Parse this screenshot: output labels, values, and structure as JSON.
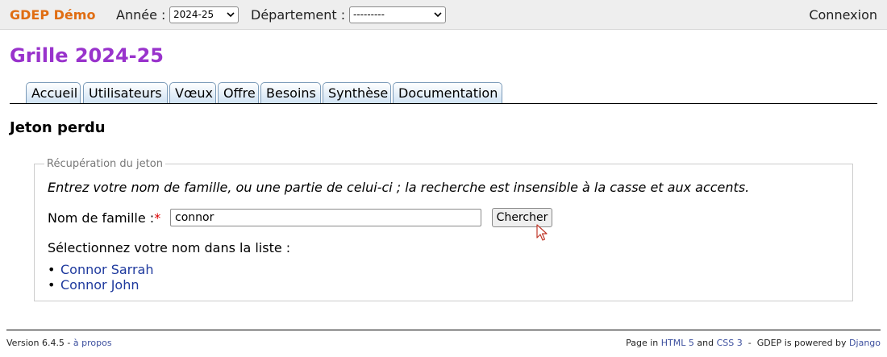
{
  "topbar": {
    "brand": "GDEP Démo",
    "year_label": "Année :",
    "year_value": "2024-25",
    "dept_label": "Département :",
    "dept_value": "---------",
    "login": "Connexion"
  },
  "page_title": "Grille 2024-25",
  "tabs": [
    {
      "label": "Accueil"
    },
    {
      "label": "Utilisateurs"
    },
    {
      "label": "Vœux"
    },
    {
      "label": "Offre"
    },
    {
      "label": "Besoins"
    },
    {
      "label": "Synthèse"
    },
    {
      "label": "Documentation"
    }
  ],
  "section_title": "Jeton perdu",
  "form": {
    "legend": "Récupération du jeton",
    "instructions": "Entrez votre nom de famille, ou une partie de celui-ci ; la recherche est insensible à la casse et aux accents.",
    "name_label": "Nom de famille :",
    "required_mark": "*",
    "name_value": "connor",
    "search_button": "Chercher",
    "select_prompt": "Sélectionnez votre nom dans la liste :",
    "results": [
      "Connor Sarrah",
      "Connor John"
    ]
  },
  "footer": {
    "version": "Version 6.4.5 - ",
    "about": "à propos",
    "page_in": "Page in ",
    "html5": "HTML 5",
    "and": " and ",
    "css3": "CSS 3",
    "powered": "  -  GDEP is powered by ",
    "django": "Django"
  },
  "colors": {
    "brand": "#e06d12",
    "title": "#9933cc",
    "link": "#1f3a9e",
    "required": "#dd0000"
  }
}
